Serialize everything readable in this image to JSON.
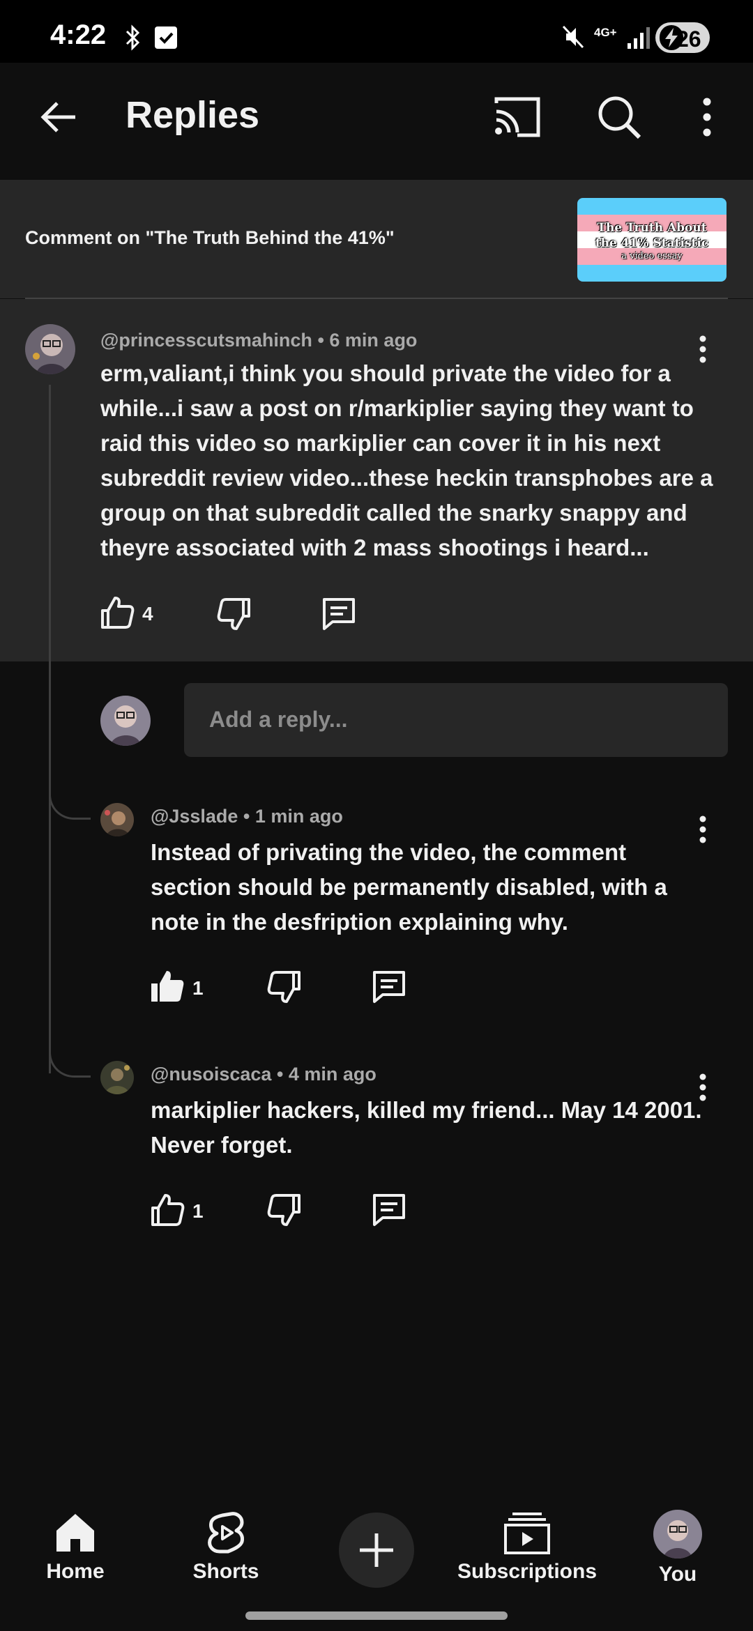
{
  "status_bar": {
    "time": "4:22",
    "network": "4G+",
    "battery": "26"
  },
  "header": {
    "title": "Replies"
  },
  "video_context": {
    "label": "Comment on \"The Truth Behind the 41%\"",
    "thumbnail_title": "The Truth About the 41% Statistic",
    "thumbnail_subtitle": "a video essay"
  },
  "parent_comment": {
    "author": "@princesscutsmahinch",
    "time": "6 min ago",
    "text": "erm,valiant,i think you should private the video for a while...i saw a post on r/markiplier saying they want to raid this video so markiplier can cover it in his next subreddit review video...these heckin transphobes are a group on that subreddit called the snarky snappy and theyre associated with 2 mass shootings i heard...",
    "likes": "4"
  },
  "reply_input": {
    "placeholder": "Add a reply..."
  },
  "replies": [
    {
      "author": "@Jsslade",
      "time": "1 min ago",
      "text": "Instead of privating the video, the comment section should be permanently disabled, with a note in the desfription explaining why.",
      "likes": "1",
      "liked": true
    },
    {
      "author": "@nusoiscaca",
      "time": "4 min ago",
      "text": "markiplier hackers, killed my friend... May 14 2001. Never forget.",
      "likes": "1",
      "liked": false
    }
  ],
  "separator": "•",
  "bottom_nav": {
    "home": "Home",
    "shorts": "Shorts",
    "subscriptions": "Subscriptions",
    "you": "You"
  },
  "colors": {
    "background": "#0f0f0f",
    "surface": "#272727",
    "text_primary": "#f1f1f1",
    "text_secondary": "#aaaaaa",
    "flag_blue": "#5bcefa",
    "flag_pink": "#f5a9b8"
  }
}
